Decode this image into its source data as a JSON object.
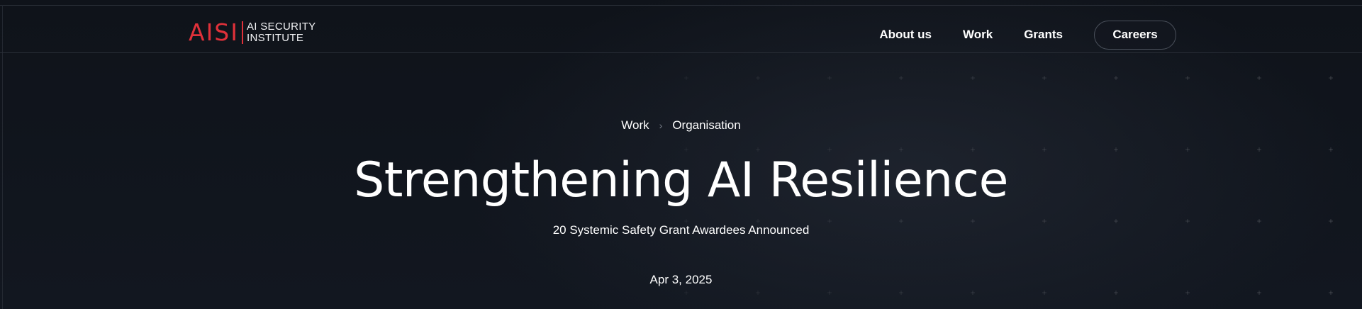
{
  "header": {
    "logo_mark": "AISI",
    "logo_line1": "AI SECURITY",
    "logo_line2": "INSTITUTE",
    "nav": {
      "about": "About us",
      "work": "Work",
      "grants": "Grants",
      "careers": "Careers"
    }
  },
  "hero": {
    "breadcrumb": [
      "Work",
      "Organisation"
    ],
    "breadcrumb_separator": "›",
    "title": "Strengthening AI Resilience",
    "subtitle": "20 Systemic Safety Grant Awardees Announced",
    "date": "Apr 3, 2025"
  },
  "colors": {
    "accent": "#e0313a",
    "background": "#0d1016",
    "text": "#ffffff"
  }
}
